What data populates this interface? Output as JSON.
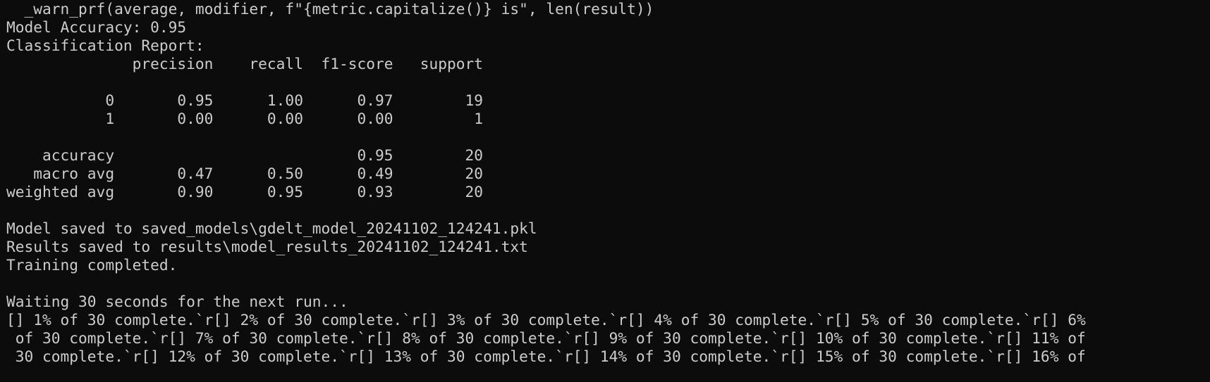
{
  "terminal": {
    "lines": [
      "  _warn_prf(average, modifier, f\"{metric.capitalize()} is\", len(result))",
      "Model Accuracy: 0.95",
      "Classification Report:",
      "              precision    recall  f1-score   support",
      "",
      "           0       0.95      1.00      0.97        19",
      "           1       0.00      0.00      0.00         1",
      "",
      "    accuracy                           0.95        20",
      "   macro avg       0.47      0.50      0.49        20",
      "weighted avg       0.90      0.95      0.93        20",
      "",
      "Model saved to saved_models\\gdelt_model_20241102_124241.pkl",
      "Results saved to results\\model_results_20241102_124241.txt",
      "Training completed.",
      "",
      "Waiting 30 seconds for the next run...",
      "[] 1% of 30 complete.`r[] 2% of 30 complete.`r[] 3% of 30 complete.`r[] 4% of 30 complete.`r[] 5% of 30 complete.`r[] 6%",
      " of 30 complete.`r[] 7% of 30 complete.`r[] 8% of 30 complete.`r[] 9% of 30 complete.`r[] 10% of 30 complete.`r[] 11% of",
      " 30 complete.`r[] 12% of 30 complete.`r[] 13% of 30 complete.`r[] 14% of 30 complete.`r[] 15% of 30 complete.`r[] 16% of"
    ]
  }
}
